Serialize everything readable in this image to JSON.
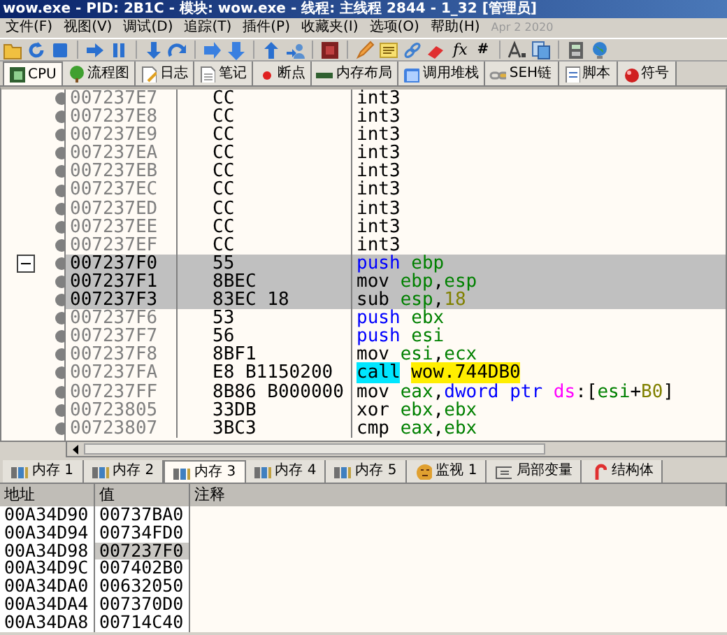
{
  "window": {
    "title": "wow.exe - PID: 2B1C - 模块: wow.exe - 线程: 主线程 2844 - 1_32 [管理员]"
  },
  "menu": [
    "文件(F)",
    "视图(V)",
    "调试(D)",
    "追踪(T)",
    "插件(P)",
    "收藏夹(I)",
    "选项(O)",
    "帮助(H)"
  ],
  "build_date": "Apr 2 2020",
  "toolbar": [
    {
      "kind": "open"
    },
    {
      "kind": "restart"
    },
    {
      "kind": "stop"
    },
    {
      "kind": "sep"
    },
    {
      "kind": "run"
    },
    {
      "kind": "pause"
    },
    {
      "kind": "sep"
    },
    {
      "kind": "step-into"
    },
    {
      "kind": "step-over"
    },
    {
      "kind": "sep"
    },
    {
      "kind": "trace-into"
    },
    {
      "kind": "trace-over"
    },
    {
      "kind": "sep"
    },
    {
      "kind": "return"
    },
    {
      "kind": "user"
    },
    {
      "kind": "sep"
    },
    {
      "kind": "script"
    },
    {
      "kind": "sep"
    },
    {
      "kind": "patch"
    },
    {
      "kind": "comment"
    },
    {
      "kind": "link"
    },
    {
      "kind": "erase"
    },
    {
      "kind": "text",
      "label": "fx"
    },
    {
      "kind": "text",
      "label": "#"
    },
    {
      "kind": "sep"
    },
    {
      "kind": "font"
    },
    {
      "kind": "copy"
    },
    {
      "kind": "sep"
    },
    {
      "kind": "calc"
    },
    {
      "kind": "globe"
    }
  ],
  "tabs": [
    {
      "label": "CPU",
      "selected": true
    },
    {
      "label": "流程图",
      "selected": false
    },
    {
      "label": "日志",
      "selected": false
    },
    {
      "label": "笔记",
      "selected": false
    },
    {
      "label": "断点",
      "selected": false
    },
    {
      "label": "内存布局",
      "selected": false
    },
    {
      "label": "调用堆栈",
      "selected": false
    },
    {
      "label": "SEH链",
      "selected": false
    },
    {
      "label": "脚本",
      "selected": false
    },
    {
      "label": "符号",
      "selected": false
    }
  ],
  "disassembly": [
    {
      "address": "007237E7",
      "bytes": "CC",
      "instruction": [
        {
          "t": "int3",
          "kind": "mnemonic"
        }
      ],
      "selected": false,
      "fold_marker": false
    },
    {
      "address": "007237E8",
      "bytes": "CC",
      "instruction": [
        {
          "t": "int3",
          "kind": "mnemonic"
        }
      ],
      "selected": false,
      "fold_marker": false
    },
    {
      "address": "007237E9",
      "bytes": "CC",
      "instruction": [
        {
          "t": "int3",
          "kind": "mnemonic"
        }
      ],
      "selected": false,
      "fold_marker": false
    },
    {
      "address": "007237EA",
      "bytes": "CC",
      "instruction": [
        {
          "t": "int3",
          "kind": "mnemonic"
        }
      ],
      "selected": false,
      "fold_marker": false
    },
    {
      "address": "007237EB",
      "bytes": "CC",
      "instruction": [
        {
          "t": "int3",
          "kind": "mnemonic"
        }
      ],
      "selected": false,
      "fold_marker": false
    },
    {
      "address": "007237EC",
      "bytes": "CC",
      "instruction": [
        {
          "t": "int3",
          "kind": "mnemonic"
        }
      ],
      "selected": false,
      "fold_marker": false
    },
    {
      "address": "007237ED",
      "bytes": "CC",
      "instruction": [
        {
          "t": "int3",
          "kind": "mnemonic"
        }
      ],
      "selected": false,
      "fold_marker": false
    },
    {
      "address": "007237EE",
      "bytes": "CC",
      "instruction": [
        {
          "t": "int3",
          "kind": "mnemonic"
        }
      ],
      "selected": false,
      "fold_marker": false
    },
    {
      "address": "007237EF",
      "bytes": "CC",
      "instruction": [
        {
          "t": "int3",
          "kind": "mnemonic"
        }
      ],
      "selected": false,
      "fold_marker": false
    },
    {
      "address": "007237F0",
      "bytes": "55",
      "instruction": [
        {
          "t": "push ",
          "kind": "stack"
        },
        {
          "t": "ebp",
          "kind": "reg"
        }
      ],
      "selected": true,
      "fold_marker": true
    },
    {
      "address": "007237F1",
      "bytes": "8BEC",
      "instruction": [
        {
          "t": "mov ",
          "kind": "mnemonic"
        },
        {
          "t": "ebp",
          "kind": "reg"
        },
        {
          "t": ",",
          "kind": "sym"
        },
        {
          "t": "esp",
          "kind": "reg"
        }
      ],
      "selected": true,
      "fold_marker": false
    },
    {
      "address": "007237F3",
      "bytes": "83EC 18",
      "instruction": [
        {
          "t": "sub ",
          "kind": "mnemonic"
        },
        {
          "t": "esp",
          "kind": "reg"
        },
        {
          "t": ",",
          "kind": "sym"
        },
        {
          "t": "18",
          "kind": "num"
        }
      ],
      "selected": true,
      "fold_marker": false
    },
    {
      "address": "007237F6",
      "bytes": "53",
      "instruction": [
        {
          "t": "push ",
          "kind": "stack"
        },
        {
          "t": "ebx",
          "kind": "reg"
        }
      ],
      "selected": false,
      "fold_marker": false
    },
    {
      "address": "007237F7",
      "bytes": "56",
      "instruction": [
        {
          "t": "push ",
          "kind": "stack"
        },
        {
          "t": "esi",
          "kind": "reg"
        }
      ],
      "selected": false,
      "fold_marker": false
    },
    {
      "address": "007237F8",
      "bytes": "8BF1",
      "instruction": [
        {
          "t": "mov ",
          "kind": "mnemonic"
        },
        {
          "t": "esi",
          "kind": "reg"
        },
        {
          "t": ",",
          "kind": "sym"
        },
        {
          "t": "ecx",
          "kind": "reg"
        }
      ],
      "selected": false,
      "fold_marker": false
    },
    {
      "address": "007237FA",
      "bytes": "E8 B1150200",
      "instruction": [
        {
          "t": "call",
          "kind": "call"
        },
        {
          "t": "wow.744DB0",
          "kind": "label"
        }
      ],
      "selected": false,
      "fold_marker": false
    },
    {
      "address": "007237FF",
      "bytes": "8B86 B000000",
      "instruction": [
        {
          "t": "mov ",
          "kind": "mnemonic"
        },
        {
          "t": "eax",
          "kind": "reg"
        },
        {
          "t": ",",
          "kind": "sym"
        },
        {
          "t": "dword ptr ",
          "kind": "size"
        },
        {
          "t": "ds",
          "kind": "seg"
        },
        {
          "t": ":[",
          "kind": "sym"
        },
        {
          "t": "esi",
          "kind": "reg"
        },
        {
          "t": "+",
          "kind": "sym"
        },
        {
          "t": "B0",
          "kind": "num"
        },
        {
          "t": "]",
          "kind": "sym"
        }
      ],
      "selected": false,
      "fold_marker": false
    },
    {
      "address": "00723805",
      "bytes": "33DB",
      "instruction": [
        {
          "t": "xor ",
          "kind": "mnemonic"
        },
        {
          "t": "ebx",
          "kind": "reg"
        },
        {
          "t": ",",
          "kind": "sym"
        },
        {
          "t": "ebx",
          "kind": "reg"
        }
      ],
      "selected": false,
      "fold_marker": false
    },
    {
      "address": "00723807",
      "bytes": "3BC3",
      "instruction": [
        {
          "t": "cmp ",
          "kind": "mnemonic"
        },
        {
          "t": "eax",
          "kind": "reg"
        },
        {
          "t": ",",
          "kind": "sym"
        },
        {
          "t": "ebx",
          "kind": "reg"
        }
      ],
      "selected": false,
      "fold_marker": false
    }
  ],
  "dump_tabs": [
    {
      "label": "内存 1",
      "selected": false
    },
    {
      "label": "内存 2",
      "selected": false
    },
    {
      "label": "内存 3",
      "selected": true
    },
    {
      "label": "内存 4",
      "selected": false
    },
    {
      "label": "内存 5",
      "selected": false
    },
    {
      "label": "监视 1",
      "selected": false
    },
    {
      "label": "局部变量",
      "selected": false
    },
    {
      "label": "结构体",
      "selected": false
    }
  ],
  "dump": {
    "columns": [
      "地址",
      "值",
      "注释"
    ],
    "rows": [
      {
        "address": "00A34D90",
        "value": "00737BA0",
        "selected": false
      },
      {
        "address": "00A34D94",
        "value": "00734FD0",
        "selected": false
      },
      {
        "address": "00A34D98",
        "value": "007237F0",
        "selected": true
      },
      {
        "address": "00A34D9C",
        "value": "007402B0",
        "selected": false
      },
      {
        "address": "00A34DA0",
        "value": "00632050",
        "selected": false
      },
      {
        "address": "00A34DA4",
        "value": "007370D0",
        "selected": false
      },
      {
        "address": "00A34DA8",
        "value": "00714C40",
        "selected": false
      }
    ]
  }
}
